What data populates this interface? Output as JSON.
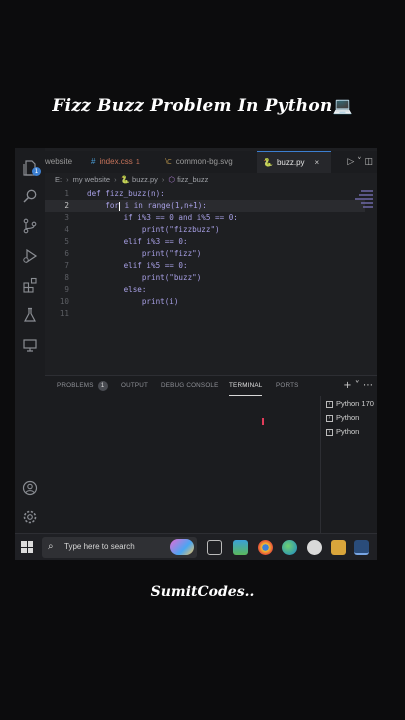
{
  "overlay": {
    "title": "Fizz Buzz Problem In Python",
    "title_emoji": "💻",
    "watermark": "SumitCodes.."
  },
  "activity_bar": {
    "items": [
      "files-icon",
      "search-icon",
      "source-control-icon",
      "run-debug-icon",
      "extensions-icon",
      "testing-icon",
      "remote-explorer-icon"
    ],
    "bottom_items": [
      "account-icon",
      "manage-gear-icon"
    ],
    "badge": "1"
  },
  "tabs": [
    {
      "label": "website",
      "icon": "",
      "modified": "",
      "active": false
    },
    {
      "label": "index.css",
      "icon": "#",
      "modified": "1",
      "active": false
    },
    {
      "label": "common-bg.svg",
      "icon": "⟈",
      "modified": "",
      "active": false
    },
    {
      "label": "buzz.py",
      "icon": "🐍",
      "modified": "",
      "active": true,
      "close": "×"
    }
  ],
  "tab_actions": "▷ ˅ ◫",
  "breadcrumb": {
    "prefix": "E:",
    "folder": "my website",
    "file": "buzz.py",
    "symbol": "fizz_buzz"
  },
  "editor": {
    "current_line": 2,
    "lines": [
      {
        "n": "1",
        "text": "def fizz_buzz(n):"
      },
      {
        "n": "2",
        "text_before_cursor": "    for",
        "text_after_cursor": " i in range(1,n+1):"
      },
      {
        "n": "3",
        "text": "        if i%3 == 0 and i%5 == 0:"
      },
      {
        "n": "4",
        "text": "            print(\"fizzbuzz\")"
      },
      {
        "n": "5",
        "text": "        elif i%3 == 0:"
      },
      {
        "n": "6",
        "text": "            print(\"fizz\")"
      },
      {
        "n": "7",
        "text": "        elif i%5 == 0:"
      },
      {
        "n": "8",
        "text": "            print(\"buzz\")"
      },
      {
        "n": "9",
        "text": "        else:"
      },
      {
        "n": "10",
        "text": "            print(i)"
      },
      {
        "n": "11",
        "text": ""
      }
    ]
  },
  "panel": {
    "tabs": [
      {
        "label": "PROBLEMS",
        "badge": "1"
      },
      {
        "label": "OUTPUT"
      },
      {
        "label": "DEBUG CONSOLE"
      },
      {
        "label": "TERMINAL",
        "active": true
      },
      {
        "label": "PORTS"
      }
    ],
    "actions": "+ ˅ ⋯",
    "terminal_sessions": [
      "Python 170",
      "Python",
      "Python"
    ]
  },
  "taskbar": {
    "search_placeholder": "Type here to search",
    "pinned_icons": [
      "task-view-icon",
      "photos-icon",
      "chrome-icon",
      "edge-icon",
      "settings-icon",
      "file-explorer-icon",
      "vscode-icon"
    ]
  },
  "colors": {
    "editor_bg": "#1e1f22",
    "code_text": "#a8a0e6",
    "accent": "#3c7fd1"
  }
}
